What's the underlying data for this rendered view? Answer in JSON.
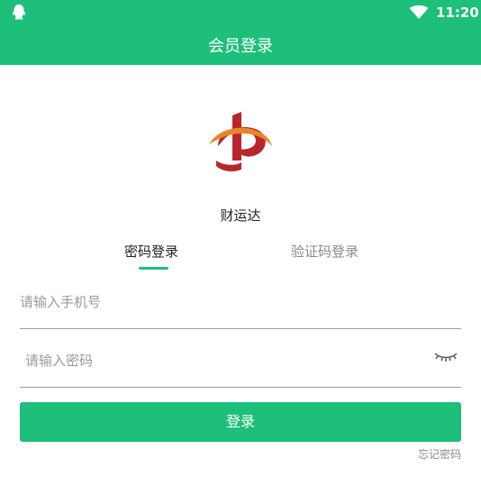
{
  "status_bar": {
    "time": "11:20",
    "icons": [
      "qq-icon",
      "wifi-icon",
      "battery-icon"
    ]
  },
  "app_bar": {
    "title": "会员登录"
  },
  "app": {
    "name": "财运达",
    "logo": "app-logo"
  },
  "tabs": [
    {
      "label": "密码登录",
      "active": true
    },
    {
      "label": "验证码登录",
      "active": false
    }
  ],
  "form": {
    "phone_placeholder": "请输入手机号",
    "password_placeholder": "请输入密码",
    "login_label": "登录",
    "forgot_label": "忘记密码"
  },
  "colors": {
    "accent": "#1dbf7a",
    "logo_red": "#b8262a",
    "logo_orange": "#e8862a"
  }
}
